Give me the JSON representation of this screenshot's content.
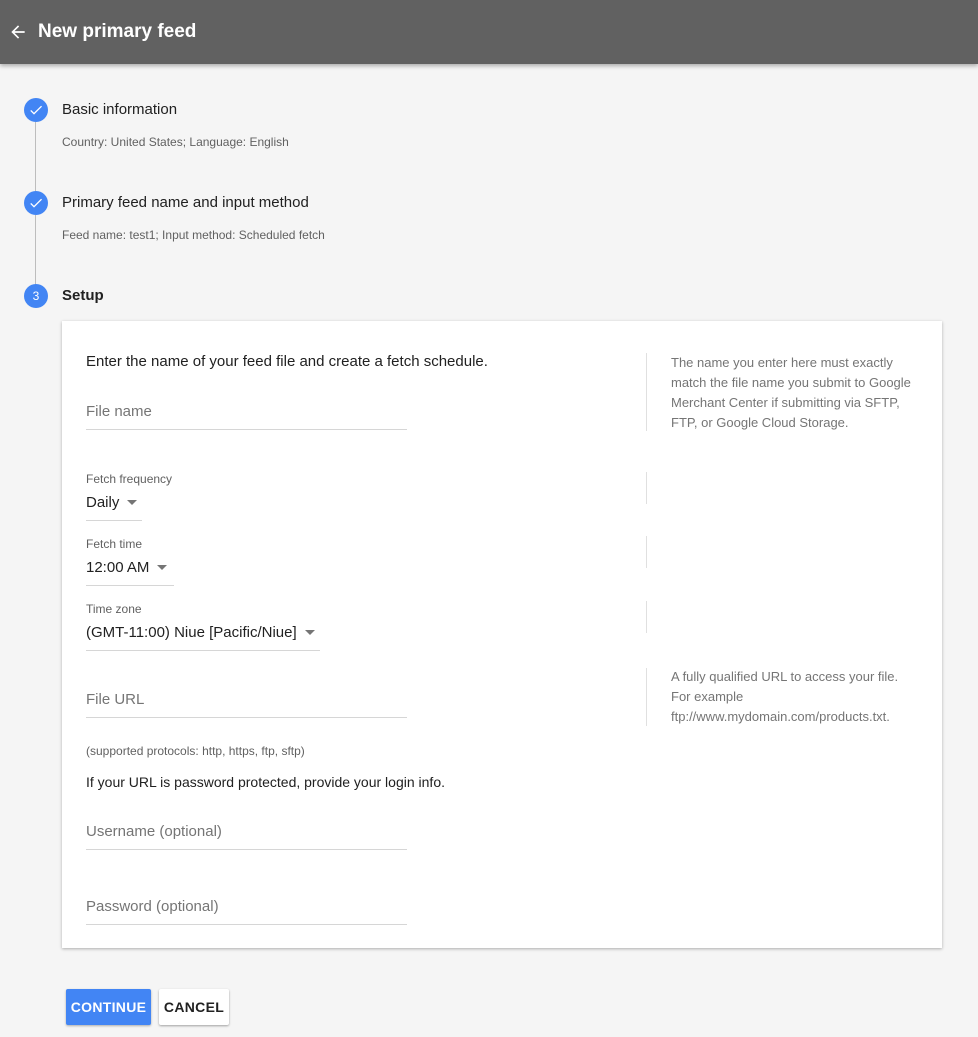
{
  "header": {
    "title": "New primary feed",
    "back_icon": "arrow-left-icon"
  },
  "steps": [
    {
      "number": "",
      "title": "Basic information",
      "summary": "Country: United States; Language: English",
      "status": "done"
    },
    {
      "number": "",
      "title": "Primary feed name and input method",
      "summary": "Feed name: test1; Input method: Scheduled fetch",
      "status": "done"
    },
    {
      "number": "3",
      "title": "Setup",
      "summary": "",
      "status": "active"
    }
  ],
  "setup": {
    "intro": "Enter the name of your feed file and create a fetch schedule.",
    "file_name_placeholder": "File name",
    "file_name_help": "The name you enter here must exactly match the file name you submit to Google Merchant Center if submitting via SFTP, FTP, or Google Cloud Storage.",
    "fetch_frequency": {
      "label": "Fetch frequency",
      "value": "Daily"
    },
    "fetch_time": {
      "label": "Fetch time",
      "value": "12:00 AM"
    },
    "time_zone": {
      "label": "Time zone",
      "value": "(GMT-11:00) Niue [Pacific/Niue]"
    },
    "file_url_placeholder": "File URL",
    "file_url_help": "A fully qualified URL to access your file. For example ftp://www.mydomain.com/products.txt.",
    "protocols_note": "(supported protocols: http, https, ftp, sftp)",
    "login_note": "If your URL is password protected, provide your login info.",
    "username_placeholder": "Username (optional)",
    "password_placeholder": "Password (optional)"
  },
  "actions": {
    "continue_label": "CONTINUE",
    "cancel_label": "CANCEL"
  },
  "colors": {
    "header": "#616161",
    "accent": "#4285f4",
    "background": "#f5f5f5"
  }
}
